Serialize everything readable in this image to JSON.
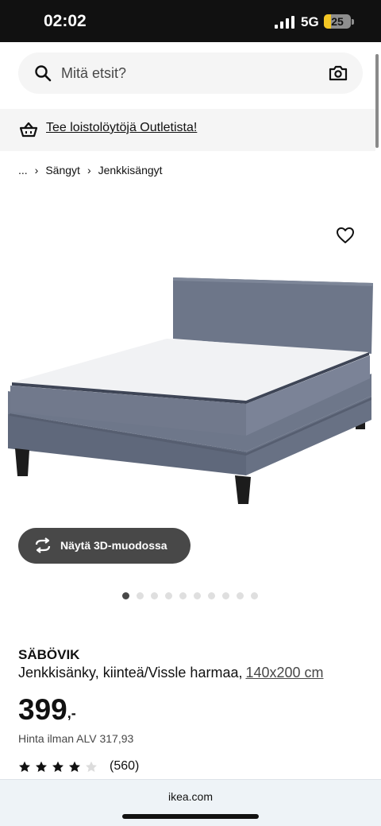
{
  "status_bar": {
    "time": "02:02",
    "network": "5G",
    "battery": "25",
    "battery_level": 0.25
  },
  "search": {
    "placeholder": "Mitä etsit?"
  },
  "outlet_banner": {
    "text": "Tee loistolöytöjä Outletista!"
  },
  "breadcrumb": {
    "ellipsis": "...",
    "items": [
      "Sängyt",
      "Jenkkisängyt"
    ]
  },
  "view_3d_button": {
    "label": "Näytä 3D-muodossa"
  },
  "carousel": {
    "total": 10,
    "active_index": 0
  },
  "product": {
    "name": "SÄBÖVIK",
    "description": "Jenkkisänky, kiinteä/Vissle harmaa,",
    "size": "140x200 cm",
    "price_integer": "399",
    "price_decimal": ",-",
    "price_ex_vat": "Hinta ilman ALV 317,93",
    "rating": 4,
    "rating_max": 5,
    "review_count": "(560)"
  },
  "browser": {
    "url": "ikea.com"
  },
  "colors": {
    "accent_dark": "#484848",
    "status_bar_bg": "#111111",
    "battery_fill": "#f3c623"
  },
  "icons": [
    "search-icon",
    "camera-icon",
    "basket-icon",
    "heart-icon",
    "rotate-3d-icon",
    "star-icon"
  ]
}
